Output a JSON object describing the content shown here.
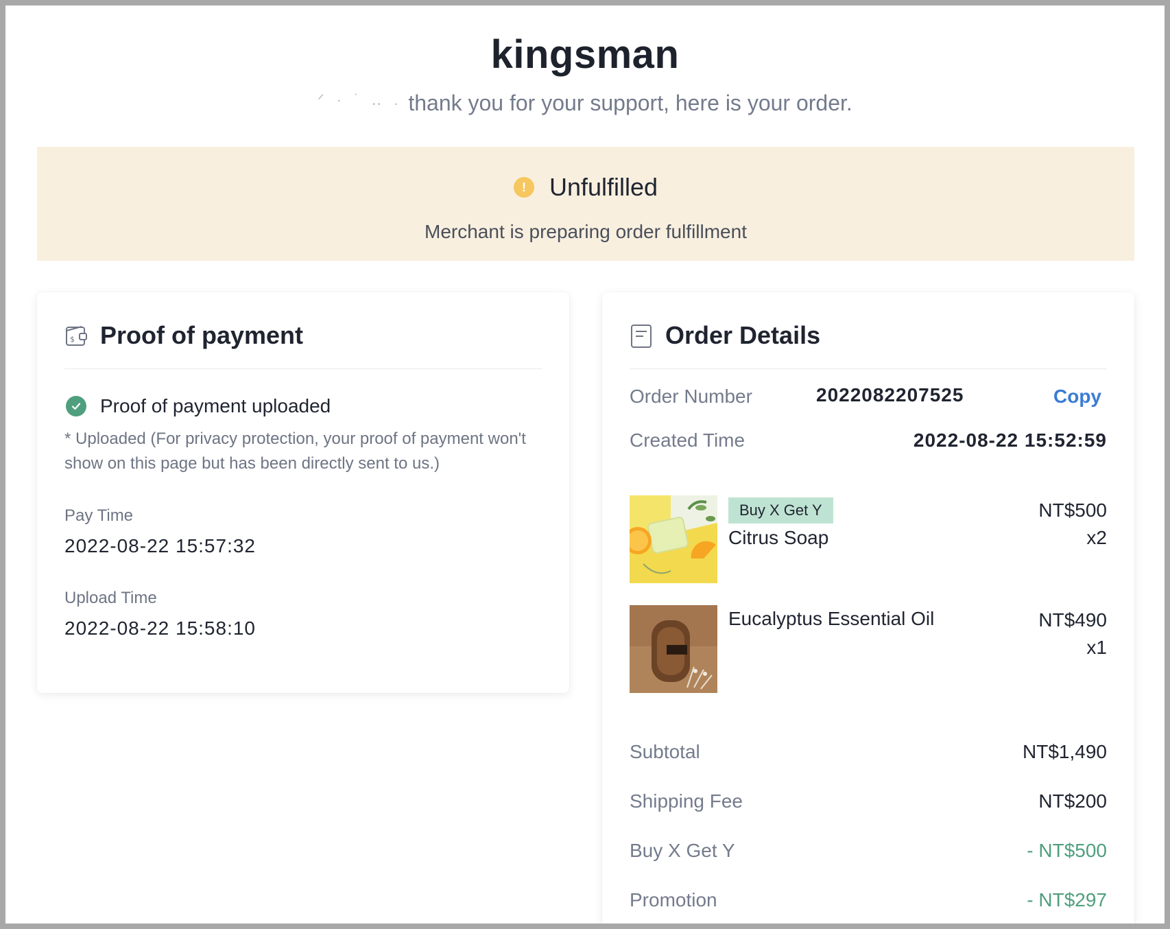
{
  "store": {
    "name": "kingsman"
  },
  "greeting": {
    "masked_name": "ᐟ · ˙ ‥ .",
    "text": "thank you for your support, here is your order."
  },
  "status": {
    "title": "Unfulfilled",
    "subtitle": "Merchant is preparing order fulfillment",
    "icon": "exclamation-icon",
    "color": "#f6c75e"
  },
  "payment": {
    "title": "Proof of payment",
    "uploaded_text": "Proof of payment uploaded",
    "note": "* Uploaded (For privacy protection, your proof of payment won't show on this page but has been directly sent to us.)",
    "pay_time_label": "Pay Time",
    "pay_time": "2022-08-22 15:57:32",
    "upload_time_label": "Upload Time",
    "upload_time": "2022-08-22 15:58:10"
  },
  "order": {
    "title": "Order Details",
    "number_label": "Order Number",
    "number": "2022082207525",
    "copy_label": "Copy",
    "created_label": "Created Time",
    "created_time": "2022-08-22 15:52:59",
    "items": [
      {
        "tag": "Buy X Get Y",
        "name": "Citrus Soap",
        "price": "NT$500",
        "qty": "x2"
      },
      {
        "tag": "",
        "name": "Eucalyptus Essential Oil",
        "price": "NT$490",
        "qty": "x1"
      }
    ],
    "summary": {
      "subtotal_label": "Subtotal",
      "subtotal": "NT$1,490",
      "shipping_label": "Shipping Fee",
      "shipping": "NT$200",
      "bxgy_label": "Buy X Get Y",
      "bxgy": "- NT$500",
      "promotion_label": "Promotion",
      "promotion": "- NT$297"
    }
  },
  "colors": {
    "accent_link": "#3a7bd5",
    "discount": "#4f9f7e",
    "banner_bg": "#f8efdf",
    "tag_bg": "#bfe3d2"
  }
}
